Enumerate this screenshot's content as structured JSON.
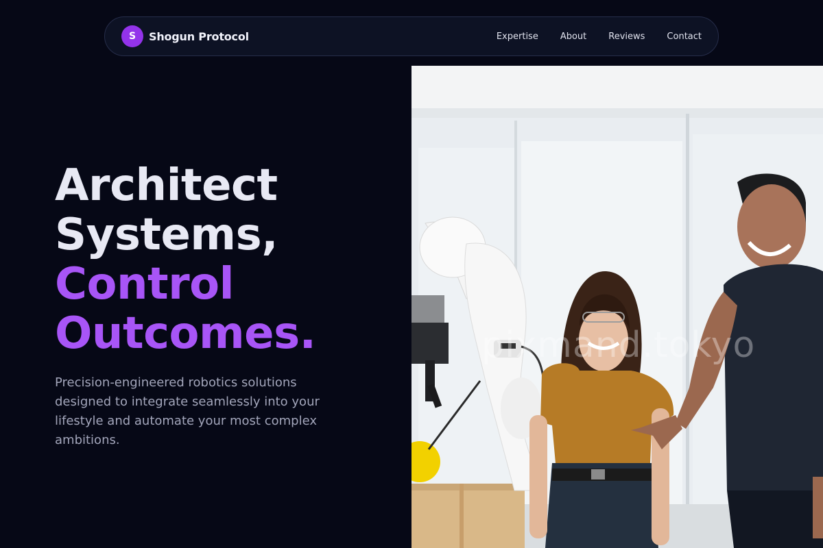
{
  "nav": {
    "brand_initial": "S",
    "brand_name": "Shogun Protocol",
    "links": [
      "Expertise",
      "About",
      "Reviews",
      "Contact"
    ]
  },
  "hero": {
    "headline_line1": "Architect",
    "headline_line2": "Systems,",
    "headline_line3": "Control",
    "headline_line4": "Outcomes.",
    "description": "Precision-engineered robotics solutions designed to integrate seamlessly into your lifestyle and automate your most complex ambitions."
  },
  "image": {
    "subject": "two people laughing beside a white robotic arm in a bright lab",
    "watermark": "pixmand.tokyo"
  },
  "colors": {
    "background": "#060816",
    "nav_bg": "#0d1224",
    "accent": "#a855f7",
    "logo_bg": "#9333ea",
    "text_primary": "#e8e9f4",
    "text_muted": "#a3a6bb"
  }
}
